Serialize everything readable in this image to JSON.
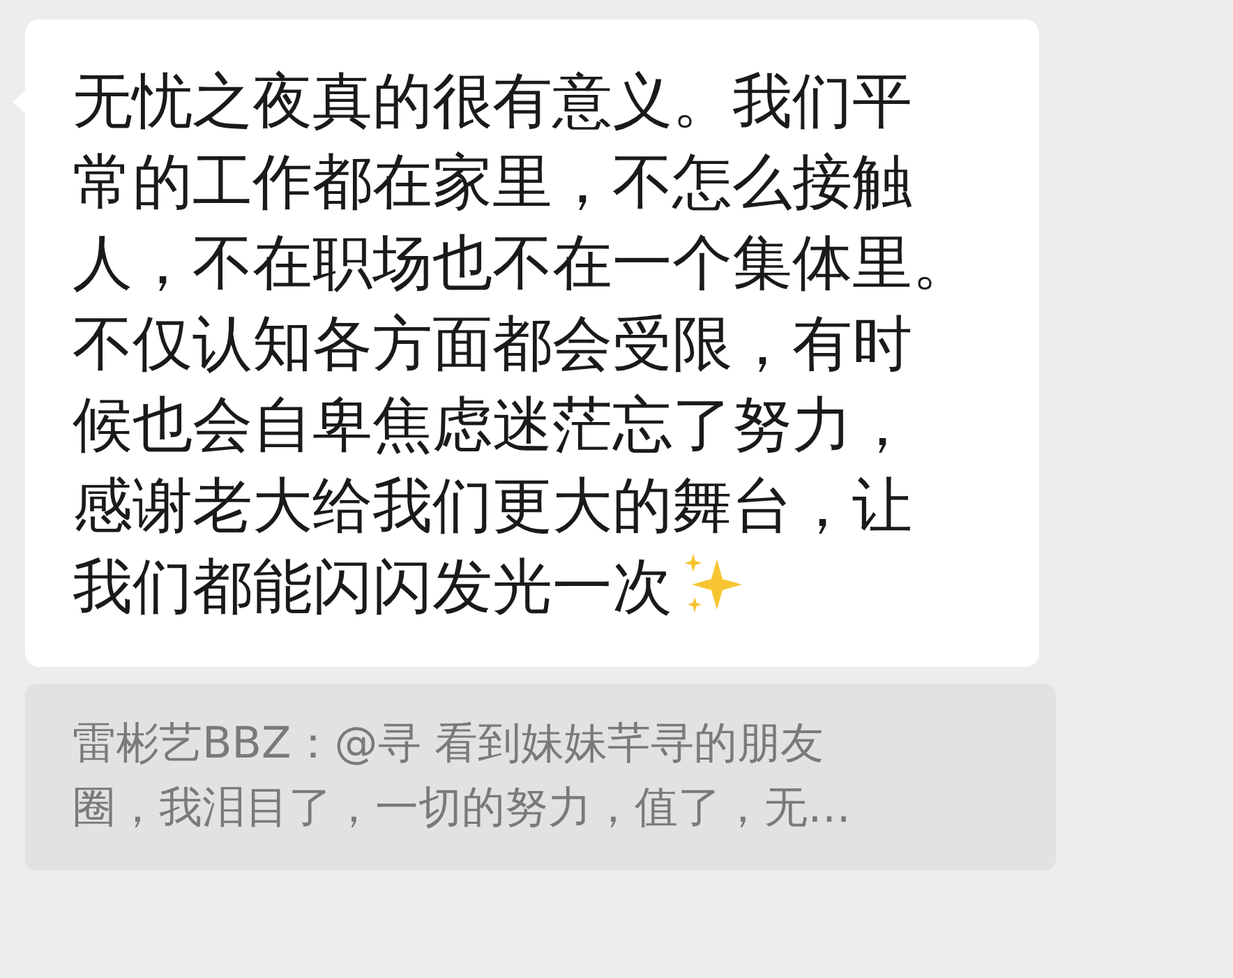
{
  "message": {
    "lines": [
      "无忧之夜真的很有意义。我们平",
      "常的工作都在家里，不怎么接触",
      "人，不在职场也不在一个集体里。",
      "不仅认知各方面都会受限，有时",
      "候也会自卑焦虑迷茫忘了努力，",
      "感谢老大给我们更大的舞台，让",
      "我们都能闪闪发光一次"
    ]
  },
  "quote": {
    "lines": [
      "雷彬艺BBZ：@寻 看到妹妹芊寻的朋友",
      "圈，我泪目了，一切的努力，值了，无…"
    ]
  }
}
